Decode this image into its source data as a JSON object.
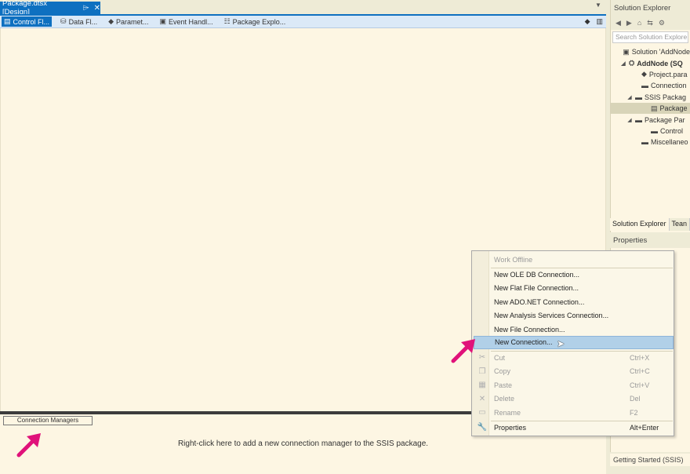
{
  "document_tab": {
    "title": "Package.dtsx [Design]",
    "pin_glyph": "⌲",
    "close_glyph": "✕"
  },
  "designer_tabs": [
    {
      "label": "Control Fl...",
      "icon": "control-flow-icon"
    },
    {
      "label": "Data Fl...",
      "icon": "data-flow-icon"
    },
    {
      "label": "Paramet...",
      "icon": "parameters-icon"
    },
    {
      "label": "Event Handl...",
      "icon": "event-handlers-icon"
    },
    {
      "label": "Package Explo...",
      "icon": "package-explorer-icon"
    }
  ],
  "connection_managers": {
    "tab_label": "Connection Managers",
    "hint": "Right-click here to add a new connection manager to the SSIS package."
  },
  "solution_explorer": {
    "title": "Solution Explorer",
    "search_placeholder": "Search Solution Explore",
    "tree": [
      {
        "label": "Solution 'AddNode",
        "indent": 0,
        "arrow": "",
        "icon": "solution-icon"
      },
      {
        "label": "AddNode (SQ",
        "indent": 1,
        "arrow": "◢",
        "icon": "project-icon",
        "bold": true
      },
      {
        "label": "Project.para",
        "indent": 2,
        "arrow": "",
        "icon": "params-file-icon"
      },
      {
        "label": "Connection",
        "indent": 2,
        "arrow": "",
        "icon": "folder-icon"
      },
      {
        "label": "SSIS Packag",
        "indent": 2,
        "arrow": "◢",
        "icon": "folder-icon"
      },
      {
        "label": "Package",
        "indent": 3,
        "arrow": "",
        "icon": "package-file-icon",
        "selected": true
      },
      {
        "label": "Package Par",
        "indent": 2,
        "arrow": "◢",
        "icon": "folder-icon"
      },
      {
        "label": "Control",
        "indent": 3,
        "arrow": "",
        "icon": "folder-icon"
      },
      {
        "label": "Miscellaneo",
        "indent": 2,
        "arrow": "",
        "icon": "folder-icon"
      }
    ],
    "bottom_tabs": [
      "Solution Explorer",
      "Tean"
    ]
  },
  "properties": {
    "title": "Properties"
  },
  "getting_started_tab": "Getting Started (SSIS)",
  "context_menu": {
    "items": [
      {
        "label": "Work Offline",
        "shortcut": "",
        "disabled": true,
        "icon": ""
      },
      {
        "label": "New OLE DB Connection...",
        "shortcut": "",
        "disabled": false,
        "icon": ""
      },
      {
        "label": "New Flat File Connection...",
        "shortcut": "",
        "disabled": false,
        "icon": ""
      },
      {
        "label": "New ADO.NET Connection...",
        "shortcut": "",
        "disabled": false,
        "icon": ""
      },
      {
        "label": "New Analysis Services Connection...",
        "shortcut": "",
        "disabled": false,
        "icon": ""
      },
      {
        "label": "New File Connection...",
        "shortcut": "",
        "disabled": false,
        "icon": ""
      },
      {
        "label": "New Connection...",
        "shortcut": "",
        "disabled": false,
        "icon": "",
        "highlighted": true
      },
      {
        "label": "Cut",
        "shortcut": "Ctrl+X",
        "disabled": true,
        "icon": "cut-icon"
      },
      {
        "label": "Copy",
        "shortcut": "Ctrl+C",
        "disabled": true,
        "icon": "copy-icon"
      },
      {
        "label": "Paste",
        "shortcut": "Ctrl+V",
        "disabled": true,
        "icon": "paste-icon"
      },
      {
        "label": "Delete",
        "shortcut": "Del",
        "disabled": true,
        "icon": "delete-icon"
      },
      {
        "label": "Rename",
        "shortcut": "F2",
        "disabled": true,
        "icon": "rename-icon"
      },
      {
        "label": "Properties",
        "shortcut": "Alt+Enter",
        "disabled": false,
        "icon": "wrench-icon"
      }
    ]
  },
  "colors": {
    "accent": "#0e70c0",
    "annotation": "#e0127a",
    "highlight": "#b1d0e8"
  }
}
